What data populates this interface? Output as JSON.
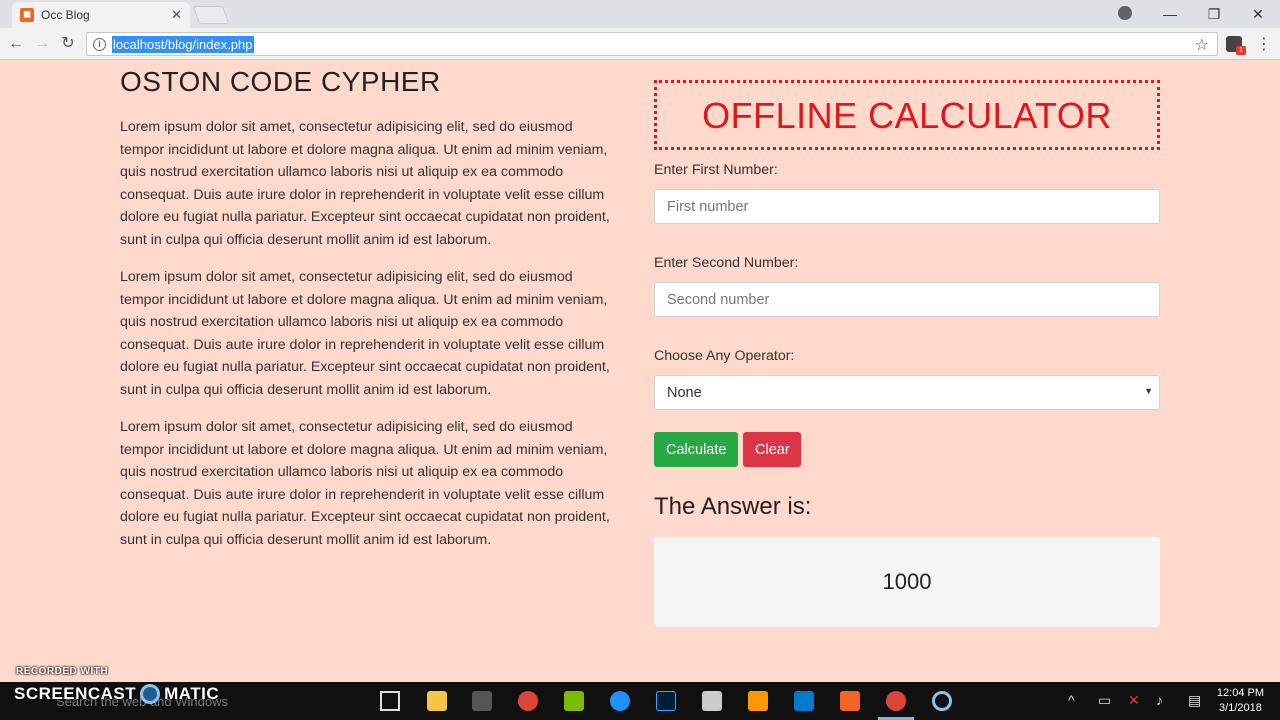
{
  "browser": {
    "tab_title": "Occ Blog",
    "url": "localhost/blog/index.php",
    "icons": [
      "page-favicon",
      "close-icon",
      "back-icon",
      "forward-icon",
      "reload-icon",
      "info-icon",
      "star-icon",
      "extension-icon",
      "menu-icon",
      "profile-icon"
    ]
  },
  "left": {
    "title": "OSTON CODE CYPHER",
    "paragraphs": [
      "Lorem ipsum dolor sit amet, consectetur adipisicing elit, sed do eiusmod tempor incididunt ut labore et dolore magna aliqua. Ut enim ad minim veniam, quis nostrud exercitation ullamco laboris nisi ut aliquip ex ea commodo consequat. Duis aute irure dolor in reprehenderit in voluptate velit esse cillum dolore eu fugiat nulla pariatur. Excepteur sint occaecat cupidatat non proident, sunt in culpa qui officia deserunt mollit anim id est laborum.",
      "Lorem ipsum dolor sit amet, consectetur adipisicing elit, sed do eiusmod tempor incididunt ut labore et dolore magna aliqua. Ut enim ad minim veniam, quis nostrud exercitation ullamco laboris nisi ut aliquip ex ea commodo consequat. Duis aute irure dolor in reprehenderit in voluptate velit esse cillum dolore eu fugiat nulla pariatur. Excepteur sint occaecat cupidatat non proident, sunt in culpa qui officia deserunt mollit anim id est laborum.",
      "Lorem ipsum dolor sit amet, consectetur adipisicing elit, sed do eiusmod tempor incididunt ut labore et dolore magna aliqua. Ut enim ad minim veniam, quis nostrud exercitation ullamco laboris nisi ut aliquip ex ea commodo consequat. Duis aute irure dolor in reprehenderit in voluptate velit esse cillum dolore eu fugiat nulla pariatur. Excepteur sint occaecat cupidatat non proident, sunt in culpa qui officia deserunt mollit anim id est laborum."
    ]
  },
  "calculator": {
    "title": "OFFLINE CALCULATOR",
    "first_label": "Enter First Number:",
    "first_placeholder": "First number",
    "second_label": "Enter Second Number:",
    "second_placeholder": "Second number",
    "operator_label": "Choose Any Operator:",
    "operator_selected": "None",
    "calculate_label": "Calculate",
    "clear_label": "Clear",
    "answer_title": "The Answer is:",
    "answer_value": "1000"
  },
  "watermark": {
    "small": "RECORDED WITH",
    "left": "SCREENCAST",
    "right": "MATIC"
  },
  "taskbar": {
    "search_placeholder": "Search the web and Windows",
    "time": "12:04 PM",
    "date": "3/1/2018"
  },
  "colors": {
    "page_bg": "#ffd9cc",
    "accent_red": "#e3141a",
    "button_green": "#28a745",
    "button_red": "#dc3545"
  }
}
